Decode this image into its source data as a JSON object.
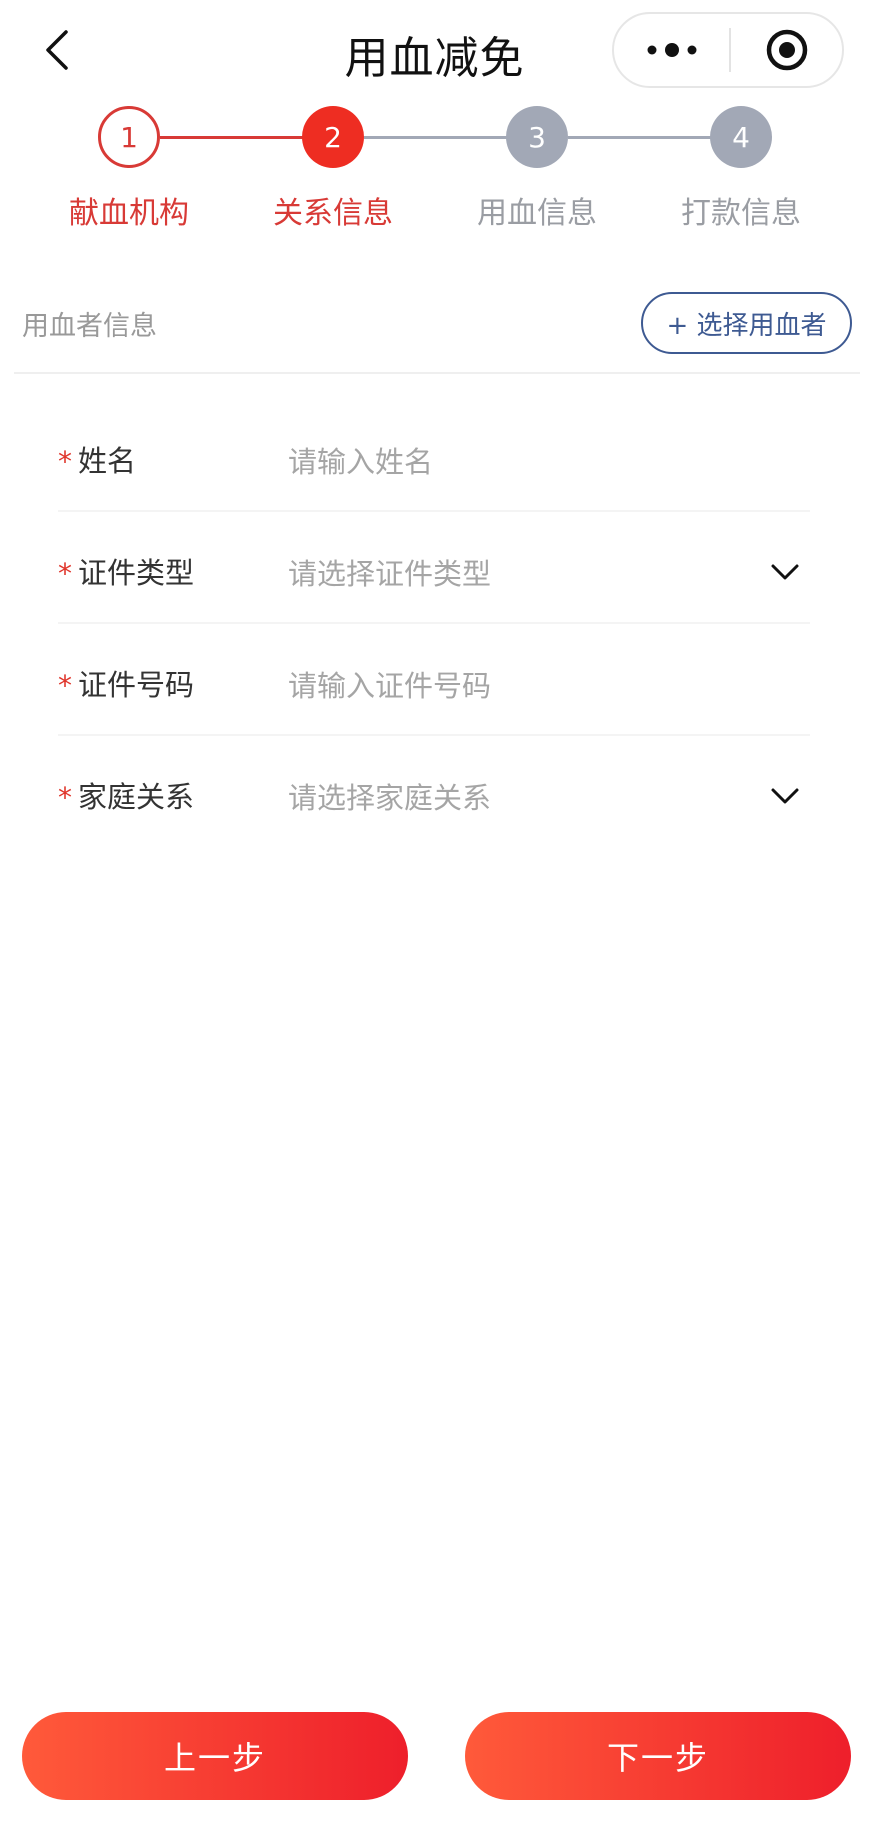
{
  "header": {
    "title": "用血减免"
  },
  "stepper": {
    "steps": [
      {
        "number": "1",
        "label": "献血机构",
        "state": "done"
      },
      {
        "number": "2",
        "label": "关系信息",
        "state": "active"
      },
      {
        "number": "3",
        "label": "用血信息",
        "state": "pending"
      },
      {
        "number": "4",
        "label": "打款信息",
        "state": "pending"
      }
    ]
  },
  "section": {
    "title": "用血者信息",
    "select_button": "+ 选择用血者"
  },
  "form": {
    "required_mark": "*",
    "name": {
      "label": "姓名",
      "placeholder": "请输入姓名"
    },
    "id_type": {
      "label": "证件类型",
      "placeholder": "请选择证件类型"
    },
    "id_number": {
      "label": "证件号码",
      "placeholder": "请输入证件号码"
    },
    "relation": {
      "label": "家庭关系",
      "placeholder": "请选择家庭关系"
    }
  },
  "actions": {
    "prev": "上一步",
    "next": "下一步"
  },
  "colors": {
    "primary_red": "#ee2d22",
    "done_red": "#d83a36",
    "pending_gray": "#a2a8b6",
    "link_blue": "#3e5a92"
  },
  "icons": {
    "back": "chevron-left-icon",
    "more": "more-dots-icon",
    "close": "target-close-icon",
    "dropdown": "chevron-down-icon"
  }
}
